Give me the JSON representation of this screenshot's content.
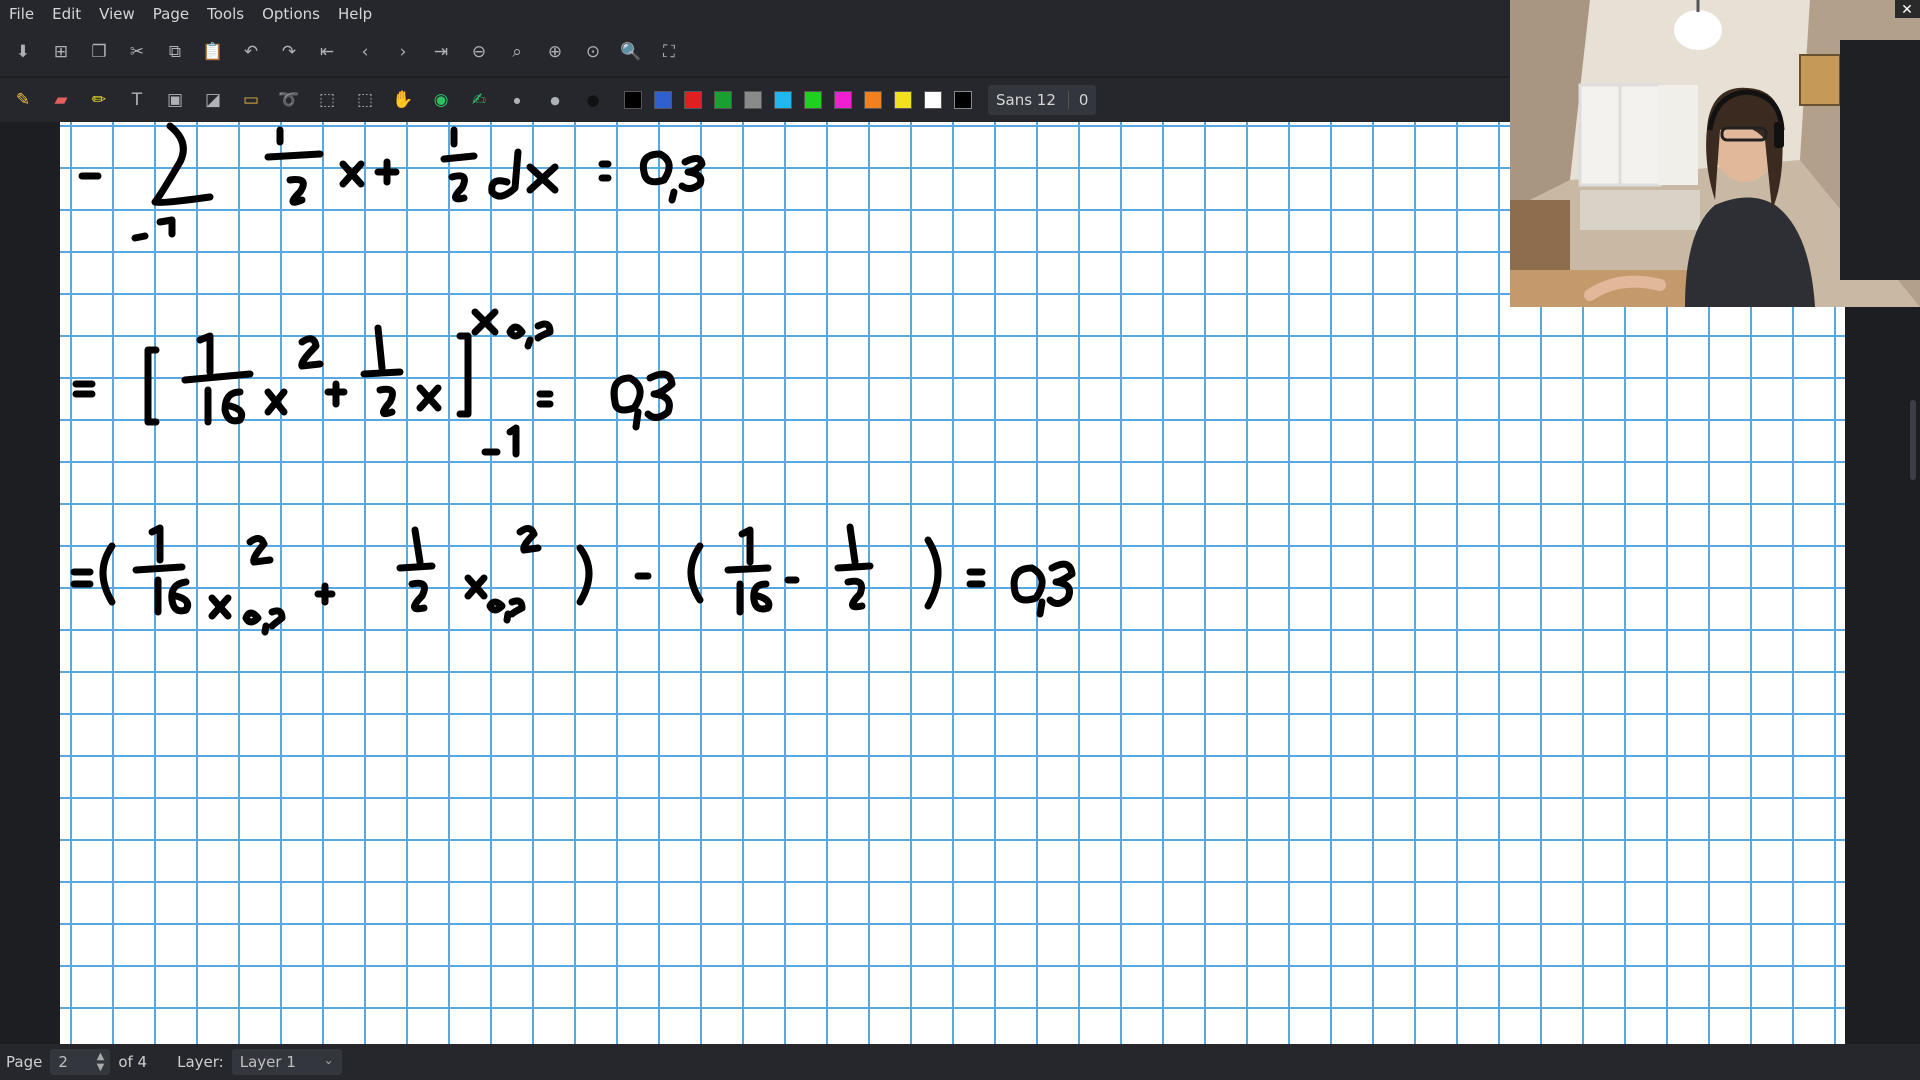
{
  "menu": [
    "File",
    "Edit",
    "View",
    "Page",
    "Tools",
    "Options",
    "Help"
  ],
  "toolbar1_icons": [
    "save-icon",
    "new-page-icon",
    "copy-page-icon",
    "cut-icon",
    "copy-icon",
    "paste-icon",
    "undo-icon",
    "redo-icon",
    "first-page-icon",
    "previous-page-icon",
    "next-page-icon",
    "last-page-icon",
    "zoom-out-icon",
    "zoom-fit-icon",
    "zoom-in-icon",
    "zoom-100-icon",
    "zoom-icon",
    "fullscreen-icon"
  ],
  "toolbar2_tools": [
    "pen-icon",
    "eraser-icon",
    "highlighter-icon",
    "text-icon",
    "image-icon",
    "shape-icon",
    "ruler-icon",
    "lasso-icon",
    "select-rect-icon",
    "select-region-icon",
    "hand-icon",
    "color-picker-icon",
    "pen-settings-icon",
    "thin-dot-icon",
    "medium-dot-icon",
    "thick-dot-icon"
  ],
  "colors": [
    "#000000",
    "#3060d0",
    "#e02020",
    "#18a030",
    "#8a8a8a",
    "#20b8f0",
    "#20d020",
    "#f020d0",
    "#f08020",
    "#f0e020",
    "#ffffff",
    "#000000"
  ],
  "font": {
    "name": "Sans 12",
    "size": "0"
  },
  "status": {
    "page_label": "Page",
    "page_value": "2",
    "of_label": "of 4",
    "layer_label": "Layer:",
    "layer_value": "Layer 1"
  }
}
